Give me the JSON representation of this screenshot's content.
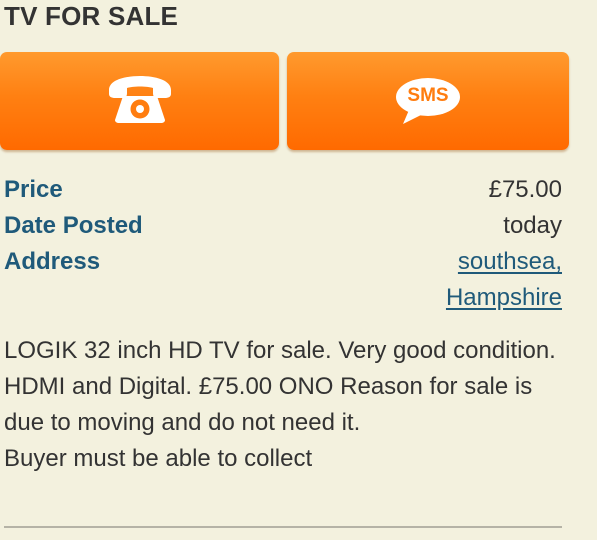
{
  "listing": {
    "title": "TV FOR SALE"
  },
  "actions": {
    "call_icon": "telephone-icon",
    "sms_label": "SMS"
  },
  "details": {
    "price_label": "Price",
    "price_value": "£75.00",
    "date_label": "Date Posted",
    "date_value": "today",
    "address_label": "Address",
    "address_line1": "southsea,",
    "address_line2": "Hampshire"
  },
  "description": {
    "line1": "LOGIK 32 inch HD TV for sale. Very good condition. HDMI and Digital. £75.00 ONO Reason for sale is due to moving and do not need it.",
    "line2": "Buyer must be able to collect"
  },
  "colors": {
    "background": "#f3f1de",
    "button_orange": "#ff7f10",
    "label_blue": "#1f5a7a",
    "text": "#333333"
  }
}
